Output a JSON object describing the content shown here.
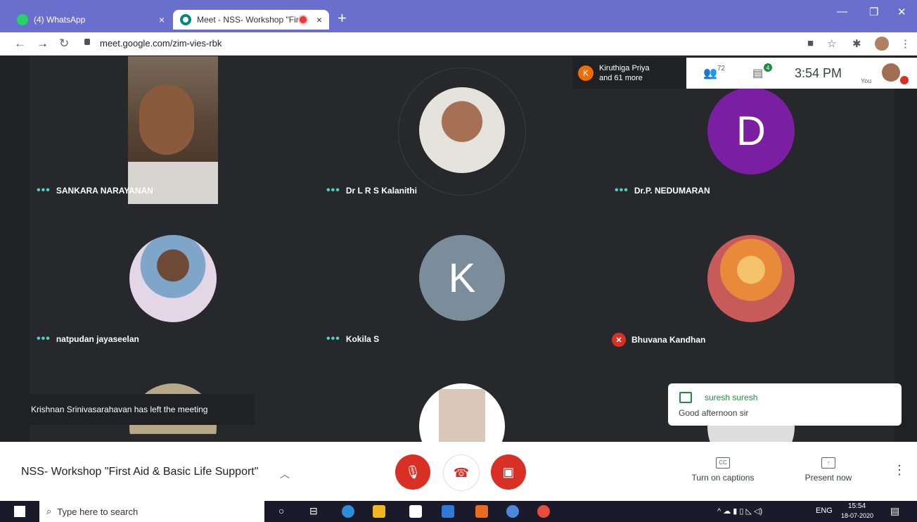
{
  "browser": {
    "tabs": [
      {
        "label": "(4) WhatsApp",
        "close": "×"
      },
      {
        "label": "Meet - NSS- Workshop \"Firs",
        "close": "×"
      }
    ],
    "new_tab": "+",
    "url": "meet.google.com/zim-vies-rbk"
  },
  "meeting": {
    "joined": {
      "initial": "K",
      "line1": "Kiruthiga Priya",
      "line2": "and 61 more"
    },
    "participant_count": "72",
    "chat_badge": "4",
    "time": "3:54 PM",
    "you_label": "You"
  },
  "participants": [
    {
      "name": "SANKARA NARAYANAN"
    },
    {
      "name": "Dr L R S Kalanithi"
    },
    {
      "name": "Dr.P. NEDUMARAN",
      "initial": "D"
    },
    {
      "name": "natpudan jayaseelan"
    },
    {
      "name": "Kokila S",
      "initial": "K"
    },
    {
      "name": "Bhuvana Kandhan"
    }
  ],
  "toast": "Krishnan Srinivasarahavan has left the meeting",
  "chat_popup": {
    "sender": "suresh suresh",
    "message": "Good afternoon sir"
  },
  "bottom_bar": {
    "title": "NSS- Workshop \"First Aid & Basic Life Support\"",
    "captions_label": "Turn on captions",
    "captions_icon": "CC",
    "present_label": "Present now"
  },
  "taskbar": {
    "search_placeholder": "Type here to search",
    "lang": "ENG",
    "time": "15:54",
    "date": "18-07-2020"
  },
  "colors": {
    "mic_off": "#d93025",
    "avatar_d": "#7b1fa2",
    "avatar_k": "#7b8d9a",
    "accent": "#1e8e3e"
  }
}
